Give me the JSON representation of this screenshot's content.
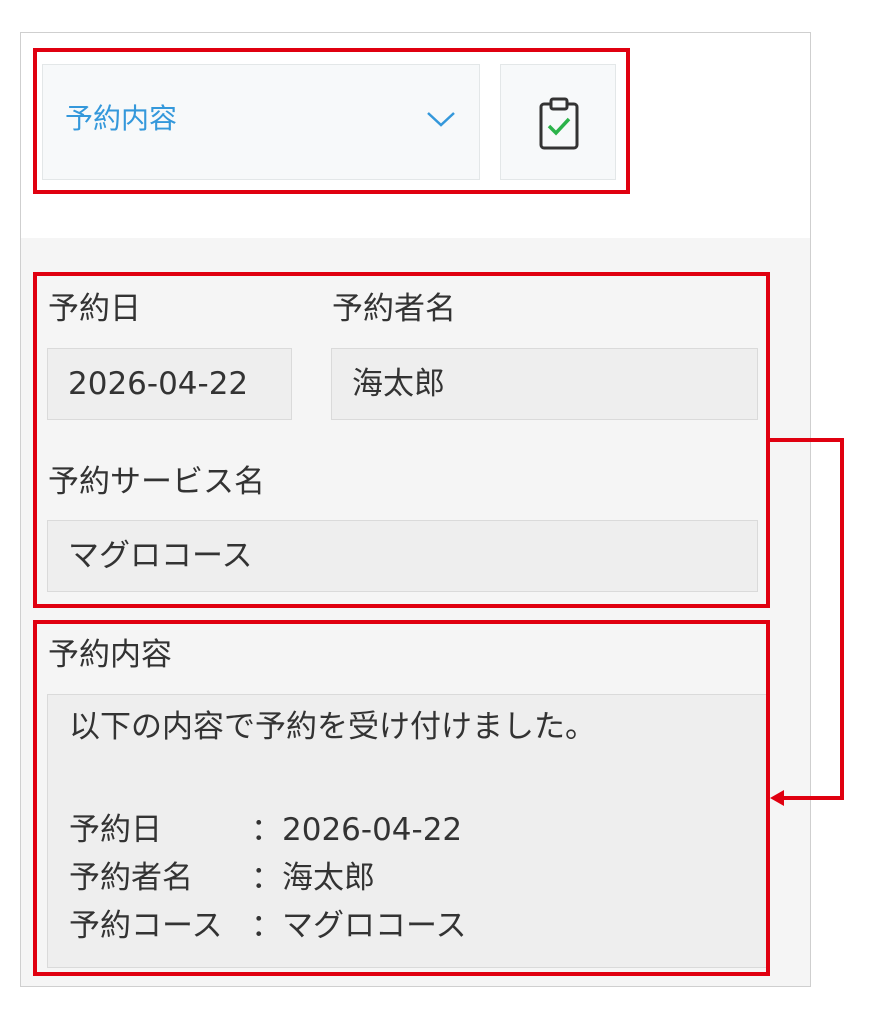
{
  "header": {
    "view_selector": {
      "selected": "予約内容",
      "icon": "chevron-down-icon"
    },
    "save_button_icon": "clipboard-check-icon"
  },
  "fields": {
    "reservation_date": {
      "label": "予約日",
      "value": "2026-04-22"
    },
    "reserver_name": {
      "label": "予約者名",
      "value": "海太郎"
    },
    "service_name": {
      "label": "予約サービス名",
      "value": "マグロコース"
    }
  },
  "details": {
    "label": "予約内容",
    "intro": "以下の内容で予約を受け付けました。",
    "lines": [
      {
        "key": "予約日",
        "value": "：2026-04-22"
      },
      {
        "key": "予約者名",
        "value": "：海太郎"
      },
      {
        "key": "予約コース",
        "value": "：マグロコース"
      }
    ]
  },
  "colors": {
    "accent": "#3498db",
    "annotation": "#e00010",
    "check": "#2bb34a"
  }
}
